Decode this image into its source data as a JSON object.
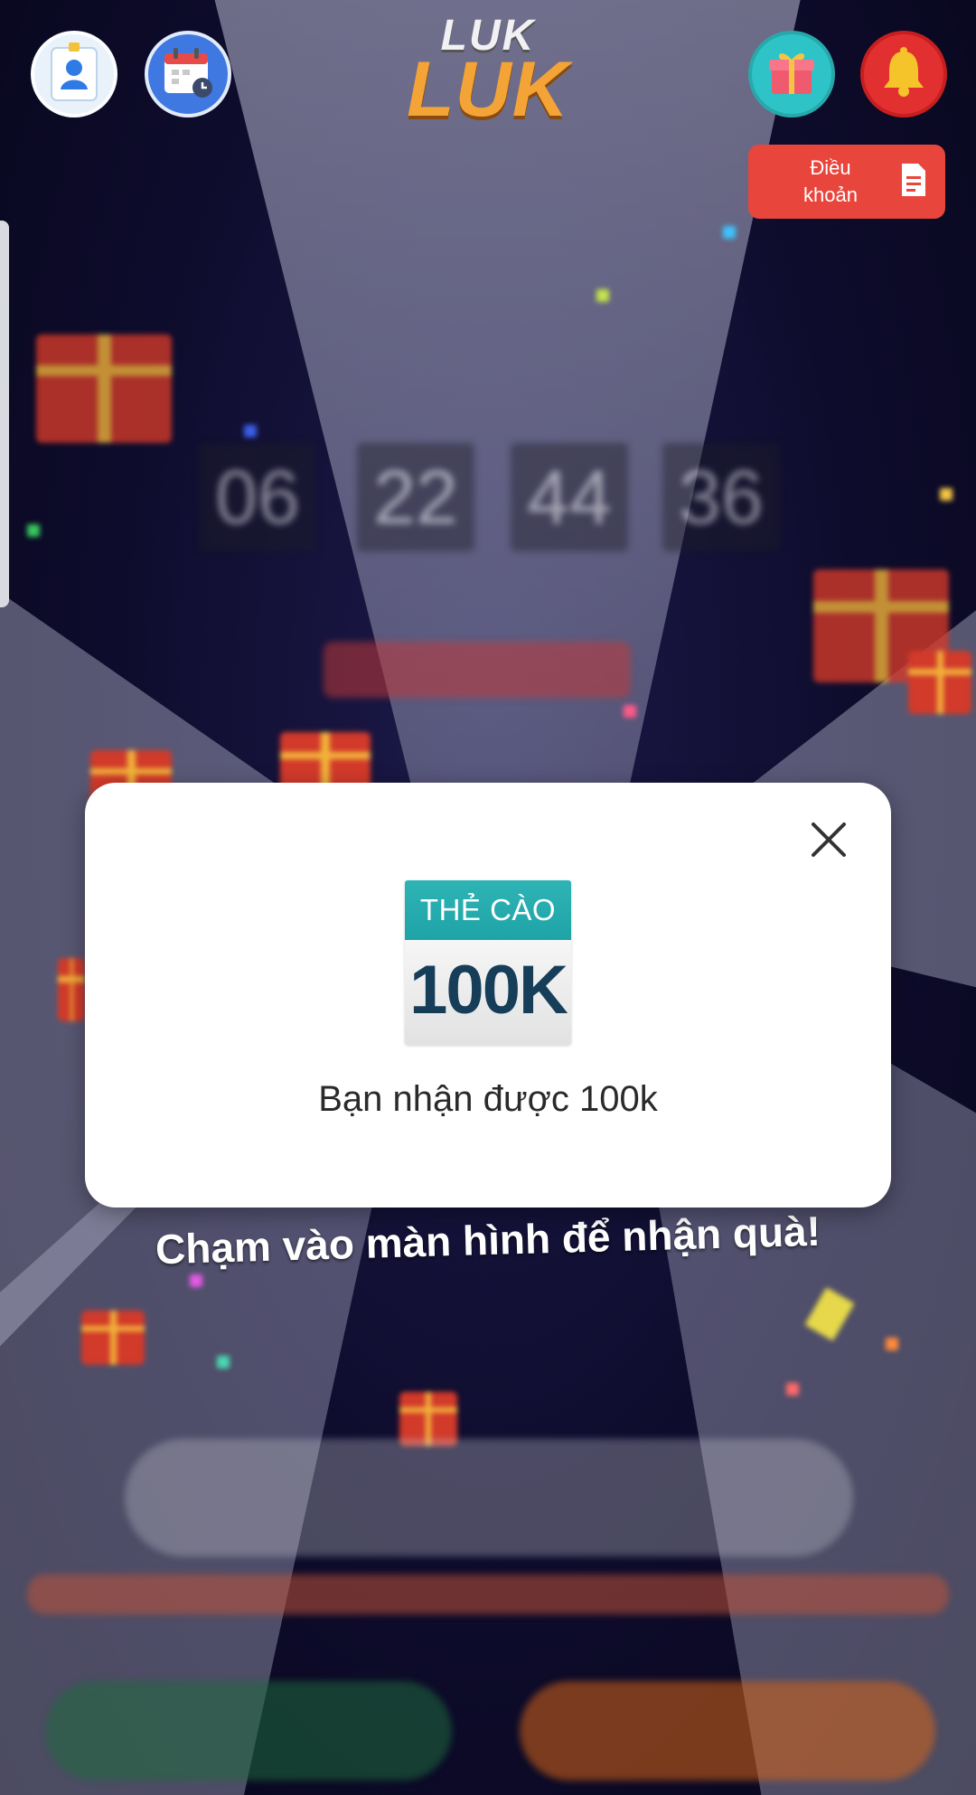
{
  "app": {
    "logo_line1": "LUK",
    "logo_line2": "LUK"
  },
  "header": {
    "profile_icon": "profile-icon",
    "calendar_icon": "calendar-icon",
    "gift_icon": "gift-icon",
    "bell_icon": "bell-icon",
    "terms_label": "Điều khoản",
    "terms_icon": "document-icon"
  },
  "background": {
    "countdown": [
      "06",
      "22",
      "44",
      "36"
    ]
  },
  "cta_text": "Chạm vào màn hình để nhận quà!",
  "modal": {
    "card_top": "THẺ CÀO",
    "card_value": "100K",
    "message": "Bạn nhận được 100k",
    "close_icon": "close-icon"
  },
  "colors": {
    "terms_button": "#e8463c",
    "card_header": "#1ea3a6",
    "card_value_text": "#163e59"
  }
}
